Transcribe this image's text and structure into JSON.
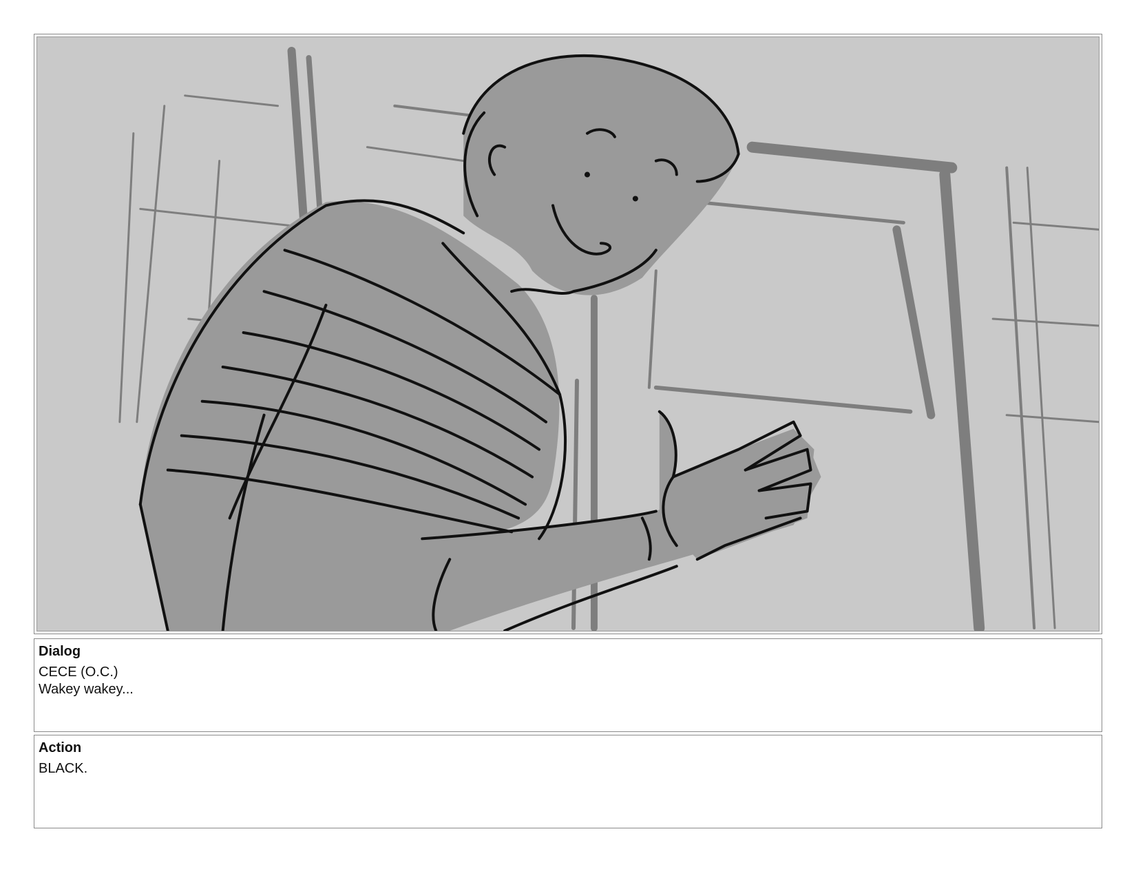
{
  "panel": {
    "image": "storyboard-sketch"
  },
  "dialog": {
    "heading": "Dialog",
    "lines": [
      "CECE (O.C.)",
      "Wakey wakey..."
    ]
  },
  "action": {
    "heading": "Action",
    "lines": [
      "BLACK."
    ]
  },
  "colors": {
    "background": "#c9c9c9",
    "fill": "#9a9a9a",
    "ink": "#111111",
    "frame_lines": "#7a7a7a"
  }
}
